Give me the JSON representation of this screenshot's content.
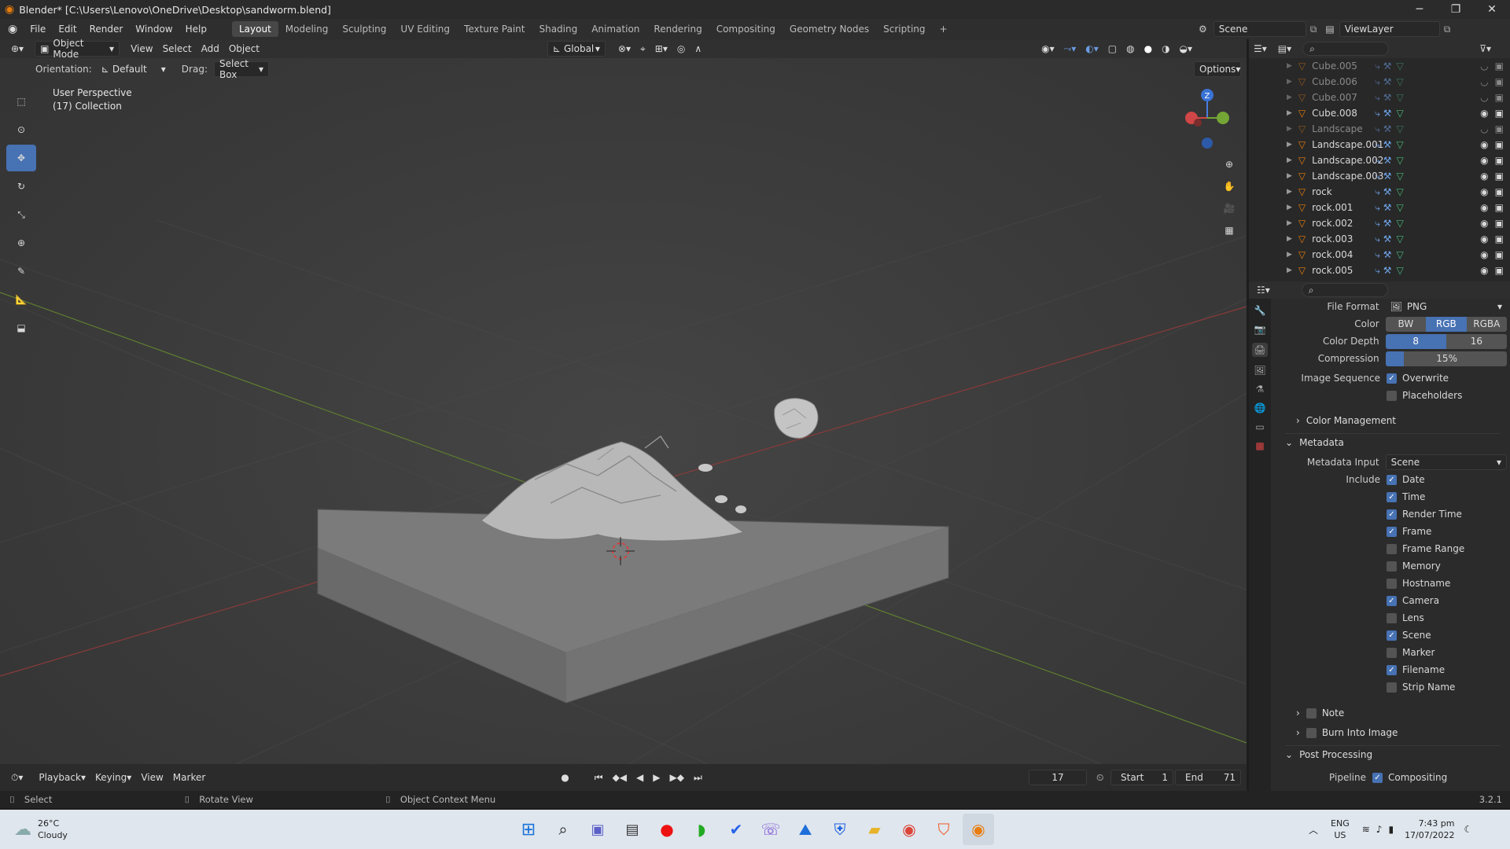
{
  "window": {
    "title": "Blender* [C:\\Users\\Lenovo\\OneDrive\\Desktop\\sandworm.blend]",
    "minimize": "─",
    "maximize": "❐",
    "close": "✕"
  },
  "menus": [
    "File",
    "Edit",
    "Render",
    "Window",
    "Help"
  ],
  "workspaces": [
    "Layout",
    "Modeling",
    "Sculpting",
    "UV Editing",
    "Texture Paint",
    "Shading",
    "Animation",
    "Rendering",
    "Compositing",
    "Geometry Nodes",
    "Scripting",
    "+"
  ],
  "scene": "Scene",
  "view_layer": "ViewLayer",
  "viewport_header": {
    "mode": "Object Mode",
    "menus": [
      "View",
      "Select",
      "Add",
      "Object"
    ],
    "transform_orientation": "Global",
    "options": "Options"
  },
  "tool_settings": {
    "orientation_label": "Orientation:",
    "orientation": "Default",
    "drag_label": "Drag:",
    "drag": "Select Box"
  },
  "overlay_text": {
    "perspective": "User Perspective",
    "collection": "(17) Collection"
  },
  "gizmo": {
    "z": "Z"
  },
  "outliner": [
    {
      "name": "Cube.005",
      "visible": false
    },
    {
      "name": "Cube.006",
      "visible": false
    },
    {
      "name": "Cube.007",
      "visible": false
    },
    {
      "name": "Cube.008",
      "visible": true
    },
    {
      "name": "Landscape",
      "visible": false
    },
    {
      "name": "Landscape.001",
      "visible": true
    },
    {
      "name": "Landscape.002",
      "visible": true
    },
    {
      "name": "Landscape.003",
      "visible": true
    },
    {
      "name": "rock",
      "visible": true
    },
    {
      "name": "rock.001",
      "visible": true
    },
    {
      "name": "rock.002",
      "visible": true
    },
    {
      "name": "rock.003",
      "visible": true
    },
    {
      "name": "rock.004",
      "visible": true
    },
    {
      "name": "rock.005",
      "visible": true
    }
  ],
  "properties": {
    "file_format_label": "File Format",
    "file_format": "PNG",
    "color_label": "Color",
    "color_options": [
      "BW",
      "RGB",
      "RGBA"
    ],
    "color_selected": "RGB",
    "depth_label": "Color Depth",
    "depth_options": [
      "8",
      "16"
    ],
    "depth_selected": "8",
    "compression_label": "Compression",
    "compression": "15%",
    "compression_fraction": 0.15,
    "image_sequence_label": "Image Sequence",
    "overwrite": "Overwrite",
    "placeholders": "Placeholders",
    "color_management": "Color Management",
    "metadata": "Metadata",
    "metadata_input_label": "Metadata Input",
    "metadata_input": "Scene",
    "include_label": "Include",
    "include": [
      {
        "label": "Date",
        "checked": true
      },
      {
        "label": "Time",
        "checked": true
      },
      {
        "label": "Render Time",
        "checked": true
      },
      {
        "label": "Frame",
        "checked": true
      },
      {
        "label": "Frame Range",
        "checked": false
      },
      {
        "label": "Memory",
        "checked": false
      },
      {
        "label": "Hostname",
        "checked": false
      },
      {
        "label": "Camera",
        "checked": true
      },
      {
        "label": "Lens",
        "checked": false
      },
      {
        "label": "Scene",
        "checked": true
      },
      {
        "label": "Marker",
        "checked": false
      },
      {
        "label": "Filename",
        "checked": true
      },
      {
        "label": "Strip Name",
        "checked": false
      }
    ],
    "note": "Note",
    "burn": "Burn Into Image",
    "post_processing": "Post Processing",
    "pipeline_label": "Pipeline",
    "compositing": "Compositing"
  },
  "timeline": {
    "menus": [
      "Playback",
      "Keying",
      "View",
      "Marker"
    ],
    "current_frame": "17",
    "start_label": "Start",
    "start": "1",
    "end_label": "End",
    "end": "71"
  },
  "statusbar": {
    "select": "Select",
    "rotate": "Rotate View",
    "context": "Object Context Menu",
    "version": "3.2.1"
  },
  "taskbar": {
    "temp": "26°C",
    "weather": "Cloudy",
    "lang": "ENG",
    "region": "US",
    "time": "7:43 pm",
    "date": "17/07/2022"
  },
  "colors": {
    "accent": "#4772b3",
    "title_bg": "#2b2b2b",
    "taskbar_bg": "#dfe6ee",
    "orange": "#e87d0d",
    "green": "#45b97a"
  }
}
